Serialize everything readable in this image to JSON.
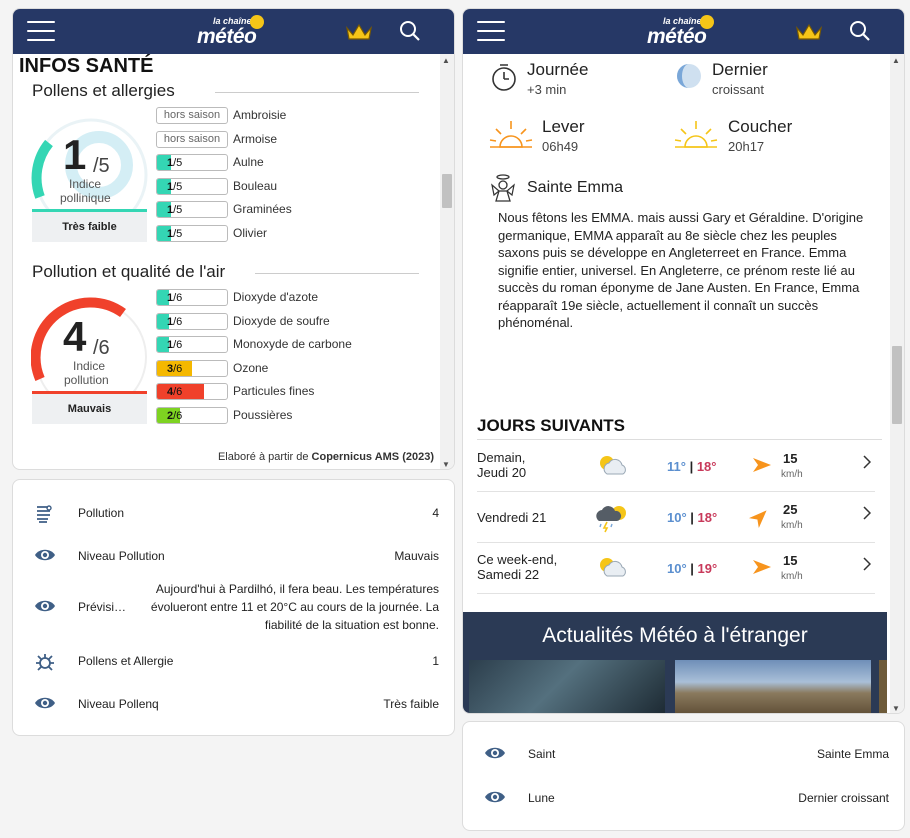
{
  "left_panel": {
    "logo_small": "la chaîne",
    "logo_large": "météo",
    "section_title": "INFOS SANTÉ",
    "pollens": {
      "title": "Pollens et allergies",
      "index_value": "1",
      "index_max": "/5",
      "index_label_1": "Indice",
      "index_label_2": "pollinique",
      "level_label": "Très faible",
      "items": [
        {
          "badge": "hors saison",
          "name": "Ambroisie",
          "off": true
        },
        {
          "badge": "hors saison",
          "name": "Armoise",
          "off": true
        },
        {
          "value": "1",
          "max": "/5",
          "name": "Aulne",
          "color": "#34d6b4",
          "level": 0.2
        },
        {
          "value": "1",
          "max": "/5",
          "name": "Bouleau",
          "color": "#34d6b4",
          "level": 0.2
        },
        {
          "value": "1",
          "max": "/5",
          "name": "Graminées",
          "color": "#34d6b4",
          "level": 0.2
        },
        {
          "value": "1",
          "max": "/5",
          "name": "Olivier",
          "color": "#34d6b4",
          "level": 0.2
        }
      ]
    },
    "pollution": {
      "title": "Pollution et qualité de l'air",
      "index_value": "4",
      "index_max": "/6",
      "index_label_1": "Indice",
      "index_label_2": "pollution",
      "level_label": "Mauvais",
      "items": [
        {
          "value": "1",
          "max": "/6",
          "name": "Dioxyde d'azote",
          "color": "#34d6b4",
          "level": 0.1667
        },
        {
          "value": "1",
          "max": "/6",
          "name": "Dioxyde de soufre",
          "color": "#34d6b4",
          "level": 0.1667
        },
        {
          "value": "1",
          "max": "/6",
          "name": "Monoxyde de carbone",
          "color": "#34d6b4",
          "level": 0.1667
        },
        {
          "value": "3",
          "max": "/6",
          "name": "Ozone",
          "color": "#f5b800",
          "level": 0.5
        },
        {
          "value": "4",
          "max": "/6",
          "name": "Particules fines",
          "color": "#f0412b",
          "level": 0.6667
        },
        {
          "value": "2",
          "max": "/6",
          "name": "Poussières",
          "color": "#7ed321",
          "level": 0.3333
        }
      ]
    },
    "source_prefix": "Elaboré à partir de ",
    "source_name": "Copernicus AMS (2023)"
  },
  "left_info": [
    {
      "label": "Pollution",
      "value": "4",
      "icon": "pollution-icon"
    },
    {
      "label": "Niveau Pollution",
      "value": "Mauvais",
      "icon": "eye-icon"
    },
    {
      "label": "Prévisi…",
      "value": "Aujourd'hui à Pardilhó, il fera beau. Les températures évolueront entre 11 et 20°C au cours de la journée. La fiabilité de la situation est bonne.",
      "icon": "eye-icon"
    },
    {
      "label": "Pollens et Allergie",
      "value": "1",
      "icon": "allergy-icon"
    },
    {
      "label": "Niveau Pollenq",
      "value": "Très faible",
      "icon": "eye-icon"
    }
  ],
  "right_panel": {
    "logo_small": "la chaîne",
    "logo_large": "météo",
    "day_title": "Journée",
    "day_sub": "+3 min",
    "moon_title": "Dernier",
    "moon_sub": "croissant",
    "sunrise_title": "Lever",
    "sunrise_time": "06h49",
    "sunset_title": "Coucher",
    "sunset_time": "20h17",
    "saint_title": "Sainte Emma",
    "saint_text": "Nous fêtons les EMMA. mais aussi Gary et Géraldine. D'origine germanique, EMMA apparaît au 8e siècle chez les peuples saxons puis se développe en Angleterreet en France. Emma signifie entier, universel. En Angleterre, ce prénom reste lié au succès du roman éponyme de Jane Austen. En France, Emma réapparaît 19e siècle, actuellement il connaît un succès phénoménal.",
    "next_title": "JOURS SUIVANTS",
    "forecast": [
      {
        "day1": "Demain,",
        "day2": "Jeudi 20",
        "tmin": "11°",
        "tmax": "18°",
        "wind": "15",
        "unit": "km/h",
        "sky": "partly-cloudy",
        "wind_angle": 0
      },
      {
        "day1": "Vendredi 21",
        "day2": "",
        "tmin": "10°",
        "tmax": "18°",
        "wind": "25",
        "unit": "km/h",
        "sky": "storm",
        "wind_angle": -45
      },
      {
        "day1": "Ce week-end,",
        "day2": "Samedi 22",
        "tmin": "10°",
        "tmax": "19°",
        "wind": "15",
        "unit": "km/h",
        "sky": "partly-cloudy",
        "wind_angle": 0
      }
    ],
    "news_title": "Actualités Météo à l'étranger"
  },
  "right_info": [
    {
      "label": "Saint",
      "value": "Sainte Emma",
      "icon": "eye-icon"
    },
    {
      "label": "Lune",
      "value": "Dernier croissant",
      "icon": "eye-icon"
    }
  ],
  "colors": {
    "header": "#263866",
    "teal": "#34d6b4",
    "red": "#f0412b",
    "tmin": "#5b8fcf",
    "tmax": "#c8395a",
    "wind_arrow": "#f7941d"
  }
}
